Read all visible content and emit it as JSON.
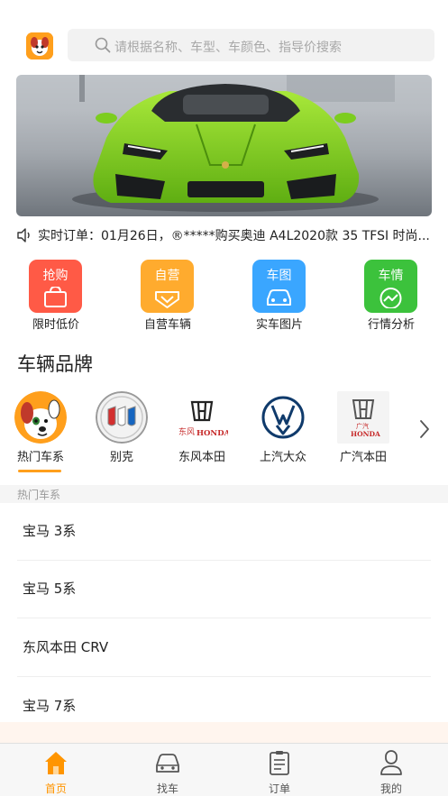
{
  "search": {
    "placeholder": "请根据名称、车型、车颜色、指导价搜索"
  },
  "ticker": {
    "text": "实时订单：01月26日，®*****购买奥迪 A4L2020款 35 TFSI 时尚..."
  },
  "quick_entries": [
    {
      "icon_text": "抢购",
      "label": "限时低价",
      "color": "#ff5a46",
      "icon": "shopping-bag-icon"
    },
    {
      "icon_text": "自营",
      "label": "自营车辆",
      "color": "#ffab2e",
      "icon": "check-badge-icon"
    },
    {
      "icon_text": "车图",
      "label": "实车图片",
      "color": "#3aa6ff",
      "icon": "car-icon"
    },
    {
      "icon_text": "车情",
      "label": "行情分析",
      "color": "#3cc23c",
      "icon": "trend-chart-icon"
    }
  ],
  "brands_section": {
    "title": "车辆品牌"
  },
  "brands": [
    {
      "label": "热门车系",
      "icon": "mascot-dog-icon"
    },
    {
      "label": "别克",
      "icon": "buick-logo-icon"
    },
    {
      "label": "东风本田",
      "icon": "dongfeng-honda-logo-icon",
      "logo_text": "东风 HONDA"
    },
    {
      "label": "上汽大众",
      "icon": "vw-logo-icon"
    },
    {
      "label": "广汽本田",
      "icon": "gac-honda-logo-icon",
      "logo_text": "广汽 HONDA"
    }
  ],
  "hot_series": {
    "header": "热门车系",
    "items": [
      "宝马 3系",
      "宝马 5系",
      "东风本田 CRV",
      "宝马 7系"
    ]
  },
  "tabbar": {
    "items": [
      {
        "label": "首页",
        "icon": "home-icon",
        "active": true
      },
      {
        "label": "找车",
        "icon": "car-icon",
        "active": false
      },
      {
        "label": "订单",
        "icon": "order-list-icon",
        "active": false
      },
      {
        "label": "我的",
        "icon": "user-icon",
        "active": false
      }
    ]
  },
  "colors": {
    "accent": "#ff9f1c",
    "active_tab": "#ff9500"
  }
}
